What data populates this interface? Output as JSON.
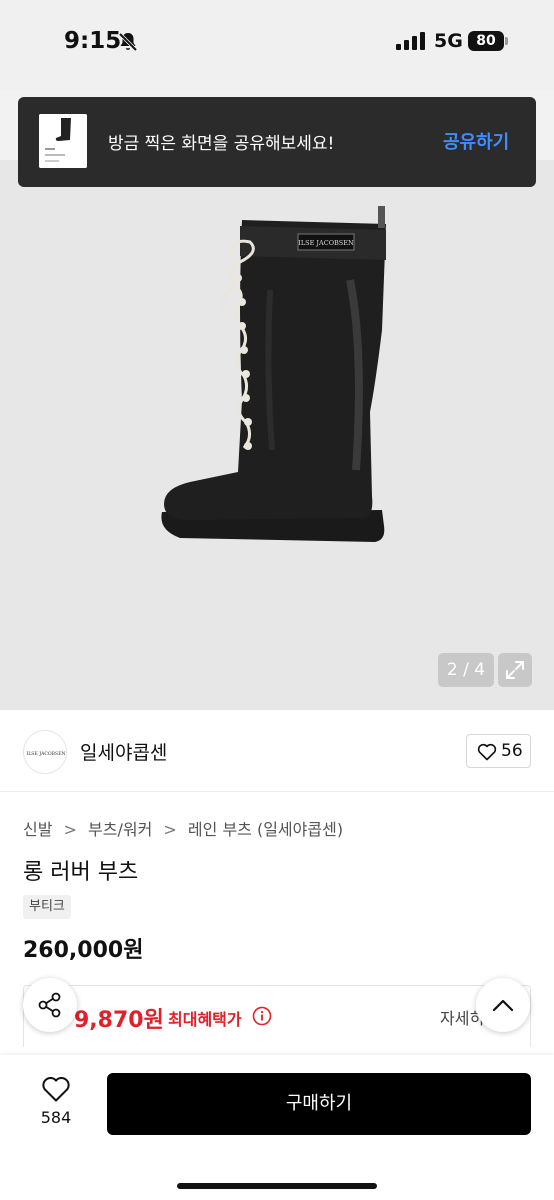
{
  "status_bar": {
    "time": "9:15",
    "network": "5G",
    "battery": "80"
  },
  "toast": {
    "message": "방금 찍은 화면을 공유해보세요!",
    "action": "공유하기"
  },
  "gallery": {
    "page_counter": "2 / 4",
    "boot_label": "ILSE JACOBSEN"
  },
  "brand": {
    "logo_text": "ILSE JACOBSEN",
    "name": "일세야콥센",
    "like_count": "56"
  },
  "breadcrumb": {
    "items": [
      "신발",
      "부츠/워커",
      "레인 부츠 (일세야콥센)"
    ],
    "separator": ">"
  },
  "product": {
    "title": "롱 러버 부츠",
    "tag": "부티크",
    "price": "260,000원"
  },
  "benefit": {
    "price": "9,870원",
    "label": "최대혜택가",
    "detail": "자세히"
  },
  "bottom_bar": {
    "wish_count": "584",
    "buy_label": "구매하기"
  },
  "colors": {
    "accent_blue": "#3f8cff",
    "sale_red": "#e0202b",
    "buy_button": "#000000"
  }
}
